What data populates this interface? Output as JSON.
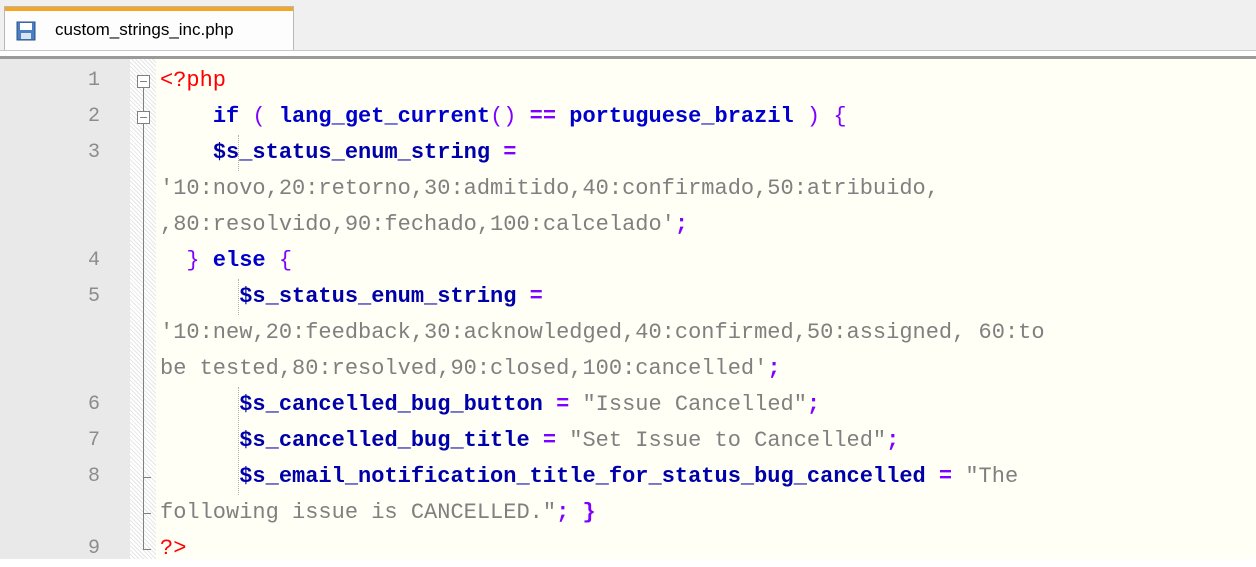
{
  "tab": {
    "label": "custom_strings_inc.php"
  },
  "lines": {
    "l1": {
      "num": "1",
      "open": "<?php"
    },
    "l2": {
      "num": "2",
      "kw": "if",
      "p1": " ( ",
      "fn": "lang_get_current",
      "p2": "()",
      "op": " == ",
      "id": "portuguese_brazil",
      "p3": " ) {"
    },
    "l3": {
      "num": "3",
      "var": "$s_status_enum_string",
      "eq": " =",
      "str1": "'10:novo,20:retorno,30:admitido,40:confirmado,50:atribuido,",
      "str2": ",80:resolvido,90:fechado,100:calcelado'",
      "semi": ";"
    },
    "l4": {
      "num": "4",
      "close": "}",
      "kw": " else",
      "brace": " {"
    },
    "l5": {
      "num": "5",
      "var": "$s_status_enum_string",
      "eq": " =",
      "str1": "'10:new,20:feedback,30:acknowledged,40:confirmed,50:assigned, 60:to",
      "str2": "be tested,80:resolved,90:closed,100:cancelled'",
      "semi": ";"
    },
    "l6": {
      "num": "6",
      "var": "$s_cancelled_bug_button",
      "eq": " = ",
      "str": "\"Issue Cancelled\"",
      "semi": ";"
    },
    "l7": {
      "num": "7",
      "var": "$s_cancelled_bug_title",
      "eq": " = ",
      "str": "\"Set Issue to Cancelled\"",
      "semi": ";"
    },
    "l8": {
      "num": "8",
      "var": "$s_email_notification_title_for_status_bug_cancelled",
      "eq": " = ",
      "str1": "\"The",
      "str2": "following issue is CANCELLED.\"",
      "semi": "; }"
    },
    "l9": {
      "num": "9",
      "close": "?>"
    }
  },
  "colors": {
    "keyword": "#0000cc",
    "variable": "#0000aa",
    "operator": "#8000ff",
    "string": "#808080",
    "php_tag": "#ff0000",
    "tab_accent": "#f5a623"
  }
}
